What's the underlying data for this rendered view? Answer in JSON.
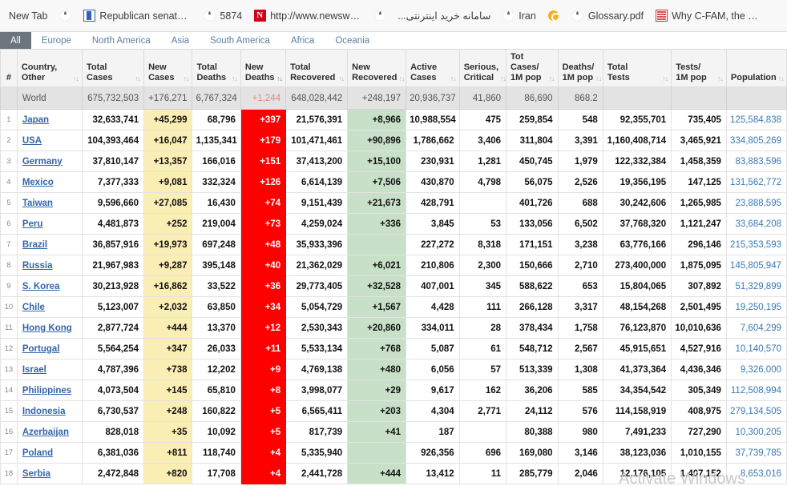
{
  "bookmarks_bar": {
    "items": [
      {
        "label": "New Tab",
        "icon": "none"
      },
      {
        "label": "",
        "icon": "globe-icon"
      },
      {
        "label": "Republican senator...",
        "icon": "blue-page-icon"
      },
      {
        "label": "5874",
        "icon": "globe-icon"
      },
      {
        "label": "http://www.newswe...",
        "icon": "newsweek-n-icon"
      },
      {
        "label": "",
        "icon": "globe-icon"
      },
      {
        "label": "سامانه خرید اینترنتی...",
        "icon": "none",
        "rtl": true
      },
      {
        "label": "Iran",
        "icon": "globe-icon"
      },
      {
        "label": "",
        "icon": "iran-swirl-icon"
      },
      {
        "label": "Glossary.pdf",
        "icon": "globe-icon"
      },
      {
        "label": "Why C-FAM, the Ca...",
        "icon": "red-doc-icon"
      }
    ]
  },
  "continent_tabs": {
    "items": [
      {
        "label": "All",
        "active": true
      },
      {
        "label": "Europe",
        "active": false
      },
      {
        "label": "North America",
        "active": false
      },
      {
        "label": "Asia",
        "active": false
      },
      {
        "label": "South America",
        "active": false
      },
      {
        "label": "Africa",
        "active": false
      },
      {
        "label": "Oceania",
        "active": false
      }
    ]
  },
  "watermark": "Activate Windows",
  "table": {
    "columns": [
      {
        "label": "#",
        "key": "idx",
        "sorted": false
      },
      {
        "label": "Country,\nOther",
        "line1": "Country,",
        "line2": "Other",
        "sorted": false
      },
      {
        "label": "Total\nCases",
        "line1": "Total",
        "line2": "Cases",
        "sorted": false
      },
      {
        "label": "New\nCases",
        "line1": "New",
        "line2": "Cases",
        "sorted": false
      },
      {
        "label": "Total\nDeaths",
        "line1": "Total",
        "line2": "Deaths",
        "sorted": false
      },
      {
        "label": "New\nDeaths",
        "line1": "New",
        "line2": "Deaths",
        "sorted": true
      },
      {
        "label": "Total\nRecovered",
        "line1": "Total",
        "line2": "Recovered",
        "sorted": false
      },
      {
        "label": "New\nRecovered",
        "line1": "New",
        "line2": "Recovered",
        "sorted": false
      },
      {
        "label": "Active\nCases",
        "line1": "Active",
        "line2": "Cases",
        "sorted": false
      },
      {
        "label": "Serious,\nCritical",
        "line1": "Serious,",
        "line2": "Critical",
        "sorted": false
      },
      {
        "label": "Tot Cases/\n1M pop",
        "line1": "Tot Cases/",
        "line2": "1M pop",
        "sorted": false
      },
      {
        "label": "Deaths/\n1M pop",
        "line1": "Deaths/",
        "line2": "1M pop",
        "sorted": false
      },
      {
        "label": "Total\nTests",
        "line1": "Total",
        "line2": "Tests",
        "sorted": false
      },
      {
        "label": "Tests/\n1M pop",
        "line1": "Tests/",
        "line2": "1M pop",
        "sorted": false
      },
      {
        "label": "Population",
        "line1": "Population",
        "line2": "",
        "sorted": false
      }
    ],
    "world_row": {
      "idx": "",
      "country": "World",
      "total_cases": "675,732,503",
      "new_cases": "+176,271",
      "total_deaths": "6,767,324",
      "new_deaths": "+1,244",
      "total_recovered": "648,028,442",
      "new_recovered": "+248,197",
      "active_cases": "20,936,737",
      "serious_critical": "41,860",
      "tot_cases_1m": "86,690",
      "deaths_1m": "868.2",
      "total_tests": "",
      "tests_1m": "",
      "population": ""
    },
    "rows": [
      {
        "idx": "1",
        "country": "Japan",
        "total_cases": "32,633,741",
        "new_cases": "+45,299",
        "total_deaths": "68,796",
        "new_deaths": "+397",
        "total_recovered": "21,576,391",
        "new_recovered": "+8,966",
        "active_cases": "10,988,554",
        "serious_critical": "475",
        "tot_cases_1m": "259,854",
        "deaths_1m": "548",
        "total_tests": "92,355,701",
        "tests_1m": "735,405",
        "population": "125,584,838"
      },
      {
        "idx": "2",
        "country": "USA",
        "total_cases": "104,393,464",
        "new_cases": "+16,047",
        "total_deaths": "1,135,341",
        "new_deaths": "+179",
        "total_recovered": "101,471,461",
        "new_recovered": "+90,896",
        "active_cases": "1,786,662",
        "serious_critical": "3,406",
        "tot_cases_1m": "311,804",
        "deaths_1m": "3,391",
        "total_tests": "1,160,408,714",
        "tests_1m": "3,465,921",
        "population": "334,805,269"
      },
      {
        "idx": "3",
        "country": "Germany",
        "total_cases": "37,810,147",
        "new_cases": "+13,357",
        "total_deaths": "166,016",
        "new_deaths": "+151",
        "total_recovered": "37,413,200",
        "new_recovered": "+15,100",
        "active_cases": "230,931",
        "serious_critical": "1,281",
        "tot_cases_1m": "450,745",
        "deaths_1m": "1,979",
        "total_tests": "122,332,384",
        "tests_1m": "1,458,359",
        "population": "83,883,596"
      },
      {
        "idx": "4",
        "country": "Mexico",
        "total_cases": "7,377,333",
        "new_cases": "+9,081",
        "total_deaths": "332,324",
        "new_deaths": "+126",
        "total_recovered": "6,614,139",
        "new_recovered": "+7,506",
        "active_cases": "430,870",
        "serious_critical": "4,798",
        "tot_cases_1m": "56,075",
        "deaths_1m": "2,526",
        "total_tests": "19,356,195",
        "tests_1m": "147,125",
        "population": "131,562,772"
      },
      {
        "idx": "5",
        "country": "Taiwan",
        "total_cases": "9,596,660",
        "new_cases": "+27,085",
        "total_deaths": "16,430",
        "new_deaths": "+74",
        "total_recovered": "9,151,439",
        "new_recovered": "+21,673",
        "active_cases": "428,791",
        "serious_critical": "",
        "tot_cases_1m": "401,726",
        "deaths_1m": "688",
        "total_tests": "30,242,606",
        "tests_1m": "1,265,985",
        "population": "23,888,595"
      },
      {
        "idx": "6",
        "country": "Peru",
        "total_cases": "4,481,873",
        "new_cases": "+252",
        "total_deaths": "219,004",
        "new_deaths": "+73",
        "total_recovered": "4,259,024",
        "new_recovered": "+336",
        "active_cases": "3,845",
        "serious_critical": "53",
        "tot_cases_1m": "133,056",
        "deaths_1m": "6,502",
        "total_tests": "37,768,320",
        "tests_1m": "1,121,247",
        "population": "33,684,208"
      },
      {
        "idx": "7",
        "country": "Brazil",
        "total_cases": "36,857,916",
        "new_cases": "+19,973",
        "total_deaths": "697,248",
        "new_deaths": "+48",
        "total_recovered": "35,933,396",
        "new_recovered": "",
        "active_cases": "227,272",
        "serious_critical": "8,318",
        "tot_cases_1m": "171,151",
        "deaths_1m": "3,238",
        "total_tests": "63,776,166",
        "tests_1m": "296,146",
        "population": "215,353,593"
      },
      {
        "idx": "8",
        "country": "Russia",
        "total_cases": "21,967,983",
        "new_cases": "+9,287",
        "total_deaths": "395,148",
        "new_deaths": "+40",
        "total_recovered": "21,362,029",
        "new_recovered": "+6,021",
        "active_cases": "210,806",
        "serious_critical": "2,300",
        "tot_cases_1m": "150,666",
        "deaths_1m": "2,710",
        "total_tests": "273,400,000",
        "tests_1m": "1,875,095",
        "population": "145,805,947"
      },
      {
        "idx": "9",
        "country": "S. Korea",
        "total_cases": "30,213,928",
        "new_cases": "+16,862",
        "total_deaths": "33,522",
        "new_deaths": "+36",
        "total_recovered": "29,773,405",
        "new_recovered": "+32,528",
        "active_cases": "407,001",
        "serious_critical": "345",
        "tot_cases_1m": "588,622",
        "deaths_1m": "653",
        "total_tests": "15,804,065",
        "tests_1m": "307,892",
        "population": "51,329,899"
      },
      {
        "idx": "10",
        "country": "Chile",
        "total_cases": "5,123,007",
        "new_cases": "+2,032",
        "total_deaths": "63,850",
        "new_deaths": "+34",
        "total_recovered": "5,054,729",
        "new_recovered": "+1,567",
        "active_cases": "4,428",
        "serious_critical": "111",
        "tot_cases_1m": "266,128",
        "deaths_1m": "3,317",
        "total_tests": "48,154,268",
        "tests_1m": "2,501,495",
        "population": "19,250,195"
      },
      {
        "idx": "11",
        "country": "Hong Kong",
        "total_cases": "2,877,724",
        "new_cases": "+444",
        "total_deaths": "13,370",
        "new_deaths": "+12",
        "total_recovered": "2,530,343",
        "new_recovered": "+20,860",
        "active_cases": "334,011",
        "serious_critical": "28",
        "tot_cases_1m": "378,434",
        "deaths_1m": "1,758",
        "total_tests": "76,123,870",
        "tests_1m": "10,010,636",
        "population": "7,604,299"
      },
      {
        "idx": "12",
        "country": "Portugal",
        "total_cases": "5,564,254",
        "new_cases": "+347",
        "total_deaths": "26,033",
        "new_deaths": "+11",
        "total_recovered": "5,533,134",
        "new_recovered": "+768",
        "active_cases": "5,087",
        "serious_critical": "61",
        "tot_cases_1m": "548,712",
        "deaths_1m": "2,567",
        "total_tests": "45,915,651",
        "tests_1m": "4,527,916",
        "population": "10,140,570"
      },
      {
        "idx": "13",
        "country": "Israel",
        "total_cases": "4,787,396",
        "new_cases": "+738",
        "total_deaths": "12,202",
        "new_deaths": "+9",
        "total_recovered": "4,769,138",
        "new_recovered": "+480",
        "active_cases": "6,056",
        "serious_critical": "57",
        "tot_cases_1m": "513,339",
        "deaths_1m": "1,308",
        "total_tests": "41,373,364",
        "tests_1m": "4,436,346",
        "population": "9,326,000"
      },
      {
        "idx": "14",
        "country": "Philippines",
        "total_cases": "4,073,504",
        "new_cases": "+145",
        "total_deaths": "65,810",
        "new_deaths": "+8",
        "total_recovered": "3,998,077",
        "new_recovered": "+29",
        "active_cases": "9,617",
        "serious_critical": "162",
        "tot_cases_1m": "36,206",
        "deaths_1m": "585",
        "total_tests": "34,354,542",
        "tests_1m": "305,349",
        "population": "112,508,994"
      },
      {
        "idx": "15",
        "country": "Indonesia",
        "total_cases": "6,730,537",
        "new_cases": "+248",
        "total_deaths": "160,822",
        "new_deaths": "+5",
        "total_recovered": "6,565,411",
        "new_recovered": "+203",
        "active_cases": "4,304",
        "serious_critical": "2,771",
        "tot_cases_1m": "24,112",
        "deaths_1m": "576",
        "total_tests": "114,158,919",
        "tests_1m": "408,975",
        "population": "279,134,505"
      },
      {
        "idx": "16",
        "country": "Azerbaijan",
        "total_cases": "828,018",
        "new_cases": "+35",
        "total_deaths": "10,092",
        "new_deaths": "+5",
        "total_recovered": "817,739",
        "new_recovered": "+41",
        "active_cases": "187",
        "serious_critical": "",
        "tot_cases_1m": "80,388",
        "deaths_1m": "980",
        "total_tests": "7,491,233",
        "tests_1m": "727,290",
        "population": "10,300,205"
      },
      {
        "idx": "17",
        "country": "Poland",
        "total_cases": "6,381,036",
        "new_cases": "+811",
        "total_deaths": "118,740",
        "new_deaths": "+4",
        "total_recovered": "5,335,940",
        "new_recovered": "",
        "active_cases": "926,356",
        "serious_critical": "696",
        "tot_cases_1m": "169,080",
        "deaths_1m": "3,146",
        "total_tests": "38,123,036",
        "tests_1m": "1,010,155",
        "population": "37,739,785"
      },
      {
        "idx": "18",
        "country": "Serbia",
        "total_cases": "2,472,848",
        "new_cases": "+820",
        "total_deaths": "17,708",
        "new_deaths": "+4",
        "total_recovered": "2,441,728",
        "new_recovered": "+444",
        "active_cases": "13,412",
        "serious_critical": "11",
        "tot_cases_1m": "285,779",
        "deaths_1m": "2,046",
        "total_tests": "12,176,105",
        "tests_1m": "1,407,152",
        "population": "8,653,016"
      }
    ]
  },
  "colors": {
    "new_cases_bg": "#fbeeb5",
    "new_deaths_bg": "#ff0000",
    "new_recovered_bg": "#c8e0c8",
    "world_row_bg": "#e3e3e3",
    "link": "#3366aa",
    "active_tab_bg": "#6c757d"
  }
}
